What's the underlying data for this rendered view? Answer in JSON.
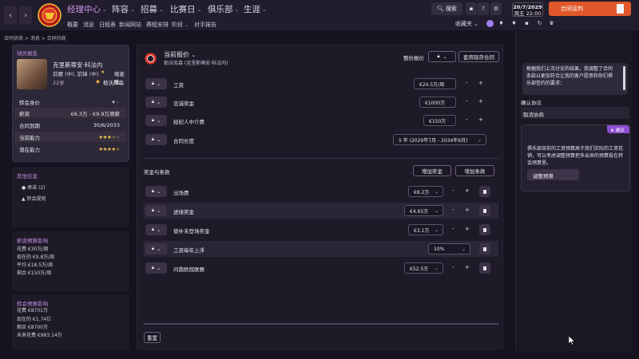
{
  "topnav": {
    "main": [
      "经理中心",
      "阵容",
      "招募",
      "比赛日",
      "俱乐部",
      "生涯"
    ],
    "sub": [
      "概要",
      "消息",
      "日程表",
      "新闻网站",
      "赛程安排",
      "阶段",
      "对手报告"
    ]
  },
  "header": {
    "search_label": "搜索",
    "date": "20/7/2029",
    "day_time": "周五 22:00",
    "continue_label": "合同谈判",
    "favorites_label": "收藏夹"
  },
  "breadcrumb": "合同协商 > 消息 > 合同协商",
  "player": {
    "section_title": "球员报告",
    "name": "克里斯蒂安·科法内",
    "position": "前腰 (中), 前锋 (中)",
    "age": "22岁",
    "nationality": "喀麦隆",
    "club": "勒沃库森",
    "stats": [
      {
        "label": "转会身价",
        "value": ""
      },
      {
        "label": "薪资",
        "value": "€6.3万 - €9.9万周薪"
      },
      {
        "label": "合同到期",
        "value": "30/6/2033"
      },
      {
        "label": "当前能力",
        "value": ""
      },
      {
        "label": "潜在能力",
        "value": ""
      }
    ],
    "current_stars": 3.5,
    "potential_stars": 4.5
  },
  "other_info": {
    "title": "其他信息",
    "items": [
      "承诺 (2)",
      "转会规则"
    ]
  },
  "wage_budget": {
    "title": "薪资预算影响",
    "lines": [
      "花费 €30万/周",
      "现在的 €9.8万/周",
      "平均 €18.5万/周",
      "剩余 €150万/周"
    ]
  },
  "transfer_budget": {
    "title": "转会预算影响",
    "lines": [
      "花费 €8701万",
      "现在的 €1.74亿",
      "剩余 €8700万",
      "未来花费 €983.14万"
    ]
  },
  "offer": {
    "title": "当前报价",
    "club_line": "勒沃库森 (克里斯蒂安·科法内)",
    "whole_offer_label": "整份报价",
    "use_existing_label": "套用现存合同",
    "terms": [
      {
        "label": "工资",
        "value": "€24.5万/周"
      },
      {
        "label": "忠诚奖金",
        "value": "€1000万"
      },
      {
        "label": "经纪人中介费",
        "value": "€150万"
      },
      {
        "label": "合同长度",
        "value": "5 年 (2029年7月 - 2034年6月)"
      }
    ],
    "bonus_title": "奖金与条款",
    "add_bonus_label": "增加奖金",
    "add_clause_label": "增加条款",
    "bonuses": [
      {
        "label": "出场费",
        "value": "€6.2万"
      },
      {
        "label": "进球奖金",
        "value": "€4.65万"
      },
      {
        "label": "替补未登场奖金",
        "value": "€3.1万"
      },
      {
        "label": "工资每年上浮",
        "value": "10%"
      },
      {
        "label": "问鼎欧冠联赛",
        "value": "€52.5万"
      }
    ],
    "reset_label": "重置"
  },
  "chat": {
    "agent_message": "根据我们上次讨论的结果，我调整了合同条款以更加符合让我的客户愿意和你们俱乐部签约的要求：",
    "options": [
      "确认协议",
      "取消协商"
    ],
    "suggestion_badge": "建议",
    "suggestion_text": "俱乐部目前的工资预算高于我们实际的工资花销，可以考虑调整预算把多出来的预算投在转会预算里。",
    "suggestion_button": "调整预算"
  },
  "colors": {
    "accent_purple": "#c48ee0",
    "continue_orange": "#e0582a",
    "star_gold": "#f3c54e"
  }
}
